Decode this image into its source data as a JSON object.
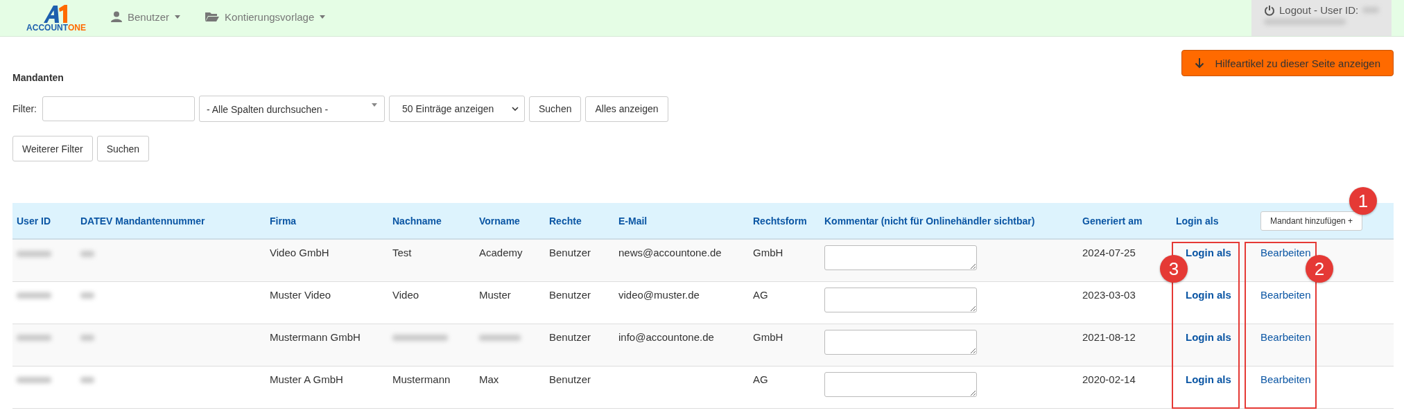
{
  "nav": {
    "logo": {
      "text": "ACCOUNT",
      "accent": "ONE"
    },
    "menus": [
      {
        "label": "Benutzer",
        "kind": "user"
      },
      {
        "label": "Kontierungsvorlage",
        "kind": "folder"
      }
    ],
    "logout": {
      "label": "Logout - User ID:"
    }
  },
  "help_button": {
    "label": "Hilfeartikel zu dieser Seite anzeigen"
  },
  "title": "Mandanten",
  "filter": {
    "label": "Filter:",
    "column_select": "- Alle Spalten durchsuchen -",
    "page_size": "50 Einträge anzeigen",
    "buttons": [
      "Suchen",
      "Alles anzeigen"
    ]
  },
  "more_filter": {
    "buttons": [
      "Weiterer Filter",
      "Suchen"
    ]
  },
  "table": {
    "columns": [
      "User ID",
      "DATEV Mandantennummer",
      "Firma",
      "Nachname",
      "Vorname",
      "Rechte",
      "E-Mail",
      "Rechtsform",
      "Kommentar (nicht für Onlinehändler sichtbar)",
      "Generiert am",
      "Login als"
    ],
    "add_button": "Mandant hinzufügen +",
    "rows": [
      {
        "user_id_hidden": true,
        "datev_hidden": true,
        "firma": "Video GmbH",
        "nachname": "Test",
        "vorname": "Academy",
        "rechte": "Benutzer",
        "email": "news@accountone.de",
        "rechtsform": "GmbH",
        "generiert": "2024-07-25",
        "login": "Login als",
        "edit": "Bearbeiten"
      },
      {
        "user_id_hidden": true,
        "datev_hidden": true,
        "firma": "Muster Video",
        "nachname": "Video",
        "vorname": "Muster",
        "rechte": "Benutzer",
        "email": "video@muster.de",
        "rechtsform": "AG",
        "generiert": "2023-03-03",
        "login": "Login als",
        "edit": "Bearbeiten"
      },
      {
        "user_id_hidden": true,
        "datev_hidden": true,
        "nachname_hidden": true,
        "vorname_hidden": true,
        "firma": "Mustermann GmbH",
        "rechte": "Benutzer",
        "email": "info@accountone.de",
        "rechtsform": "GmbH",
        "generiert": "2021-08-12",
        "login": "Login als",
        "edit": "Bearbeiten"
      },
      {
        "user_id_hidden": true,
        "datev_hidden": true,
        "firma": "Muster A GmbH",
        "nachname": "Mustermann",
        "vorname": "Max",
        "rechte": "Benutzer",
        "rechtsform": "AG",
        "generiert": "2020-02-14",
        "login": "Login als",
        "edit": "Bearbeiten"
      }
    ]
  },
  "callouts": [
    {
      "number": "1"
    },
    {
      "number": "2"
    },
    {
      "number": "3"
    }
  ]
}
